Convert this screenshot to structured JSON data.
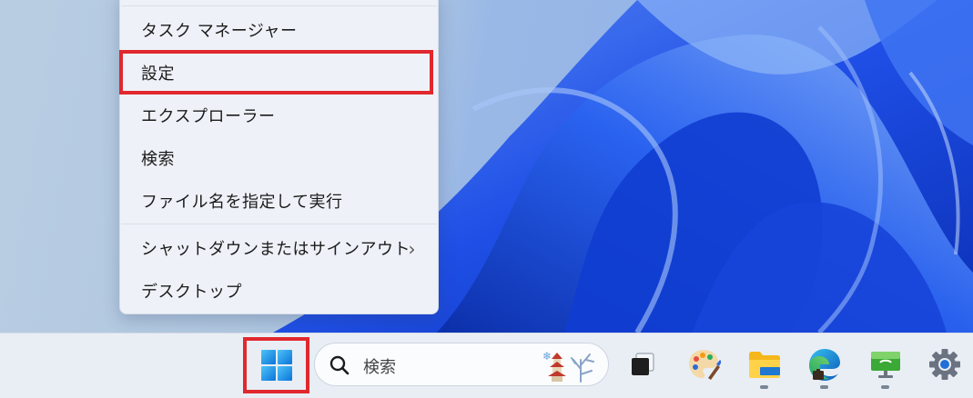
{
  "context_menu": {
    "items": [
      {
        "label": "タスク マネージャー"
      },
      {
        "label": "設定"
      },
      {
        "label": "エクスプローラー"
      },
      {
        "label": "検索"
      },
      {
        "label": "ファイル名を指定して実行"
      },
      {
        "label": "シャットダウンまたはサインアウト",
        "submenu_indicator": "›"
      },
      {
        "label": "デスクトップ"
      }
    ]
  },
  "taskbar": {
    "start_icon": "windows-logo-icon",
    "search": {
      "placeholder": "検索",
      "icon": "search-icon"
    },
    "apps": [
      {
        "name": "task-view-icon"
      },
      {
        "name": "paint-icon"
      },
      {
        "name": "file-explorer-icon"
      },
      {
        "name": "edge-icon"
      },
      {
        "name": "remote-desktop-icon"
      },
      {
        "name": "settings-gear-icon"
      }
    ]
  },
  "colors": {
    "highlight": "#e0282e",
    "menu_background": "#eef2f8",
    "taskbar_background": "#e9eef5",
    "wallpaper_blue": "#1f52e8"
  }
}
